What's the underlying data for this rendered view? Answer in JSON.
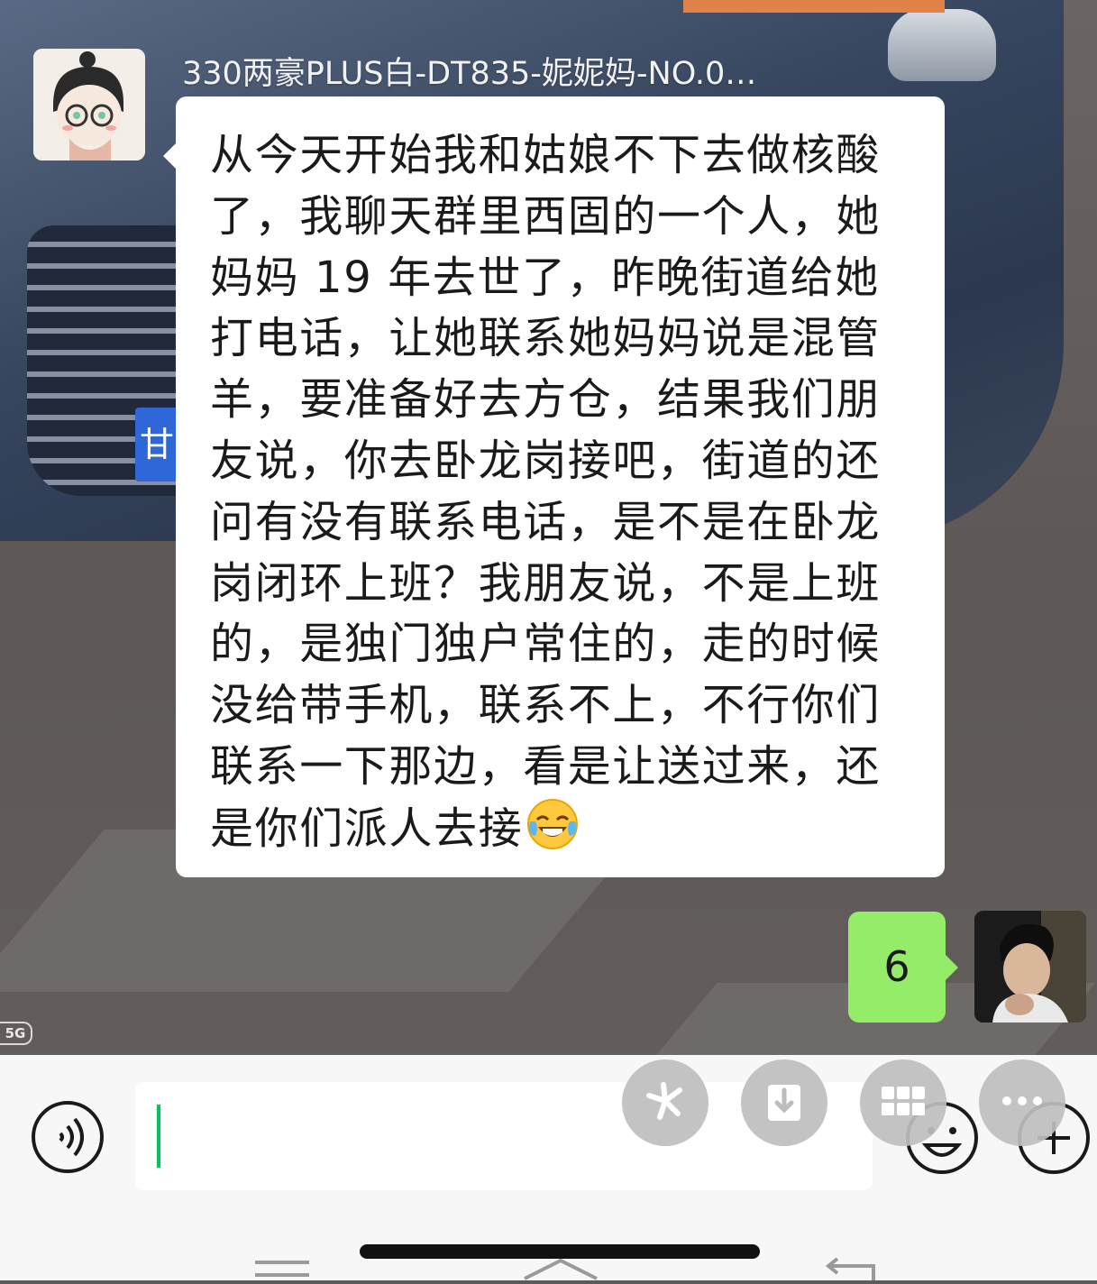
{
  "chat": {
    "sender_name": "330两豪PLUS白-DT835-妮妮妈-NO.0…",
    "incoming_message": "从今天开始我和姑娘不下去做核酸了，我聊天群里西固的一个人，她妈妈 19 年去世了，昨晚街道给她打电话，让她联系她妈妈说是混管羊，要准备好去方仓，结果我们朋友说，你去卧龙岗接吧，街道的还问有没有联系电话，是不是在卧龙岗闭环上班？我朋友说，不是上班的，是独门独户常住的，走的时候没给带手机，联系不上，不行你们联系一下那边，看是让送过来，还是你们派人去接",
    "incoming_emoji": "laughing-crying-emoji",
    "outgoing_message": "6"
  },
  "background": {
    "plate_char": "甘",
    "network_badge": "5G"
  },
  "input_bar": {
    "text_value": "",
    "icons": [
      "voice-icon",
      "emoji-icon",
      "plus-icon"
    ]
  },
  "floating_actions": [
    "pinwheel-icon",
    "download-icon",
    "grid-icon",
    "more-icon"
  ],
  "colors": {
    "outgoing_bubble": "#95ec69",
    "incoming_bubble": "#ffffff",
    "caret": "#07c160",
    "input_bar_bg": "#f7f7f7"
  }
}
